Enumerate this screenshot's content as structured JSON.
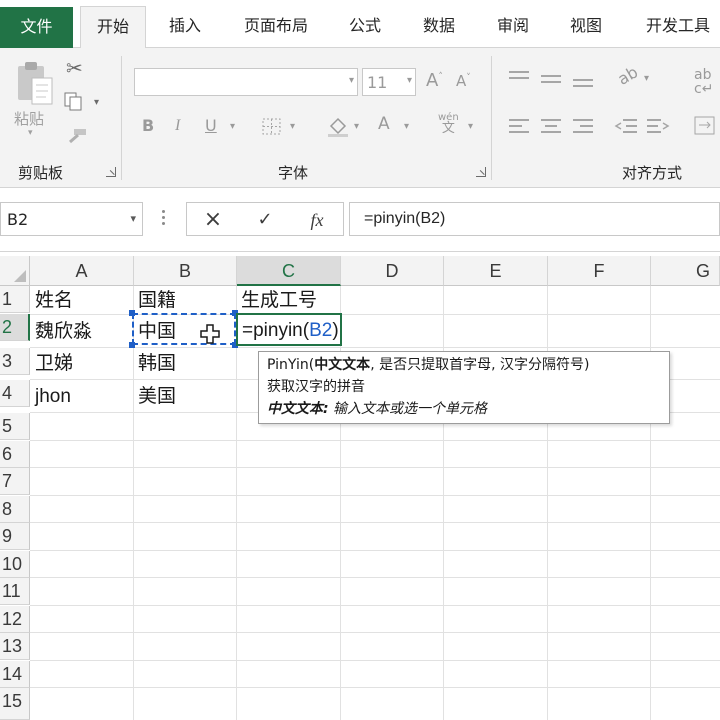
{
  "tabs": [
    {
      "label": "文件"
    },
    {
      "label": "开始"
    },
    {
      "label": "插入"
    },
    {
      "label": "页面布局"
    },
    {
      "label": "公式"
    },
    {
      "label": "数据"
    },
    {
      "label": "审阅"
    },
    {
      "label": "视图"
    },
    {
      "label": "开发工具"
    }
  ],
  "ribbon": {
    "clipboard": {
      "paste_label": "粘贴",
      "group_label": "剪贴板"
    },
    "font": {
      "group_label": "字体",
      "font_name": "",
      "font_size": "11"
    },
    "alignment": {
      "group_label": "对齐方式"
    }
  },
  "formula_bar": {
    "name_box": "B2",
    "cancel_icon": "×",
    "enter_icon": "✓",
    "fx_label": "fx",
    "formula": "=pinyin(B2)"
  },
  "sheet": {
    "columns": [
      "A",
      "B",
      "C",
      "D",
      "E",
      "F",
      "G"
    ],
    "rows": [
      "1",
      "2",
      "3",
      "4",
      "5",
      "6",
      "7",
      "8",
      "9",
      "10",
      "11",
      "12",
      "13",
      "14",
      "15"
    ],
    "cells": {
      "A1": "姓名",
      "B1": "国籍",
      "C1": "生成工号",
      "A2": "魏欣淼",
      "B2": "中国",
      "C2_prefix": "=pinyin(",
      "C2_ref": "B2",
      "C2_suffix": ")",
      "A3": "卫娣",
      "B3": "韩国",
      "A4": "jhon",
      "B4": "美国"
    },
    "active_cell": "C2",
    "referenced_range": "B2"
  },
  "tooltip": {
    "line1_func": "PinYin(",
    "line1_arg": "中文文本",
    "line1_rest": ", 是否只提取首字母, 汉字分隔符号)",
    "line2": "获取汉字的拼音",
    "line3_arg": "中文文本:",
    "line3_desc": " 输入文本或选一个单元格"
  },
  "colors": {
    "accent": "#217346",
    "reference": "#1f5fc7"
  }
}
